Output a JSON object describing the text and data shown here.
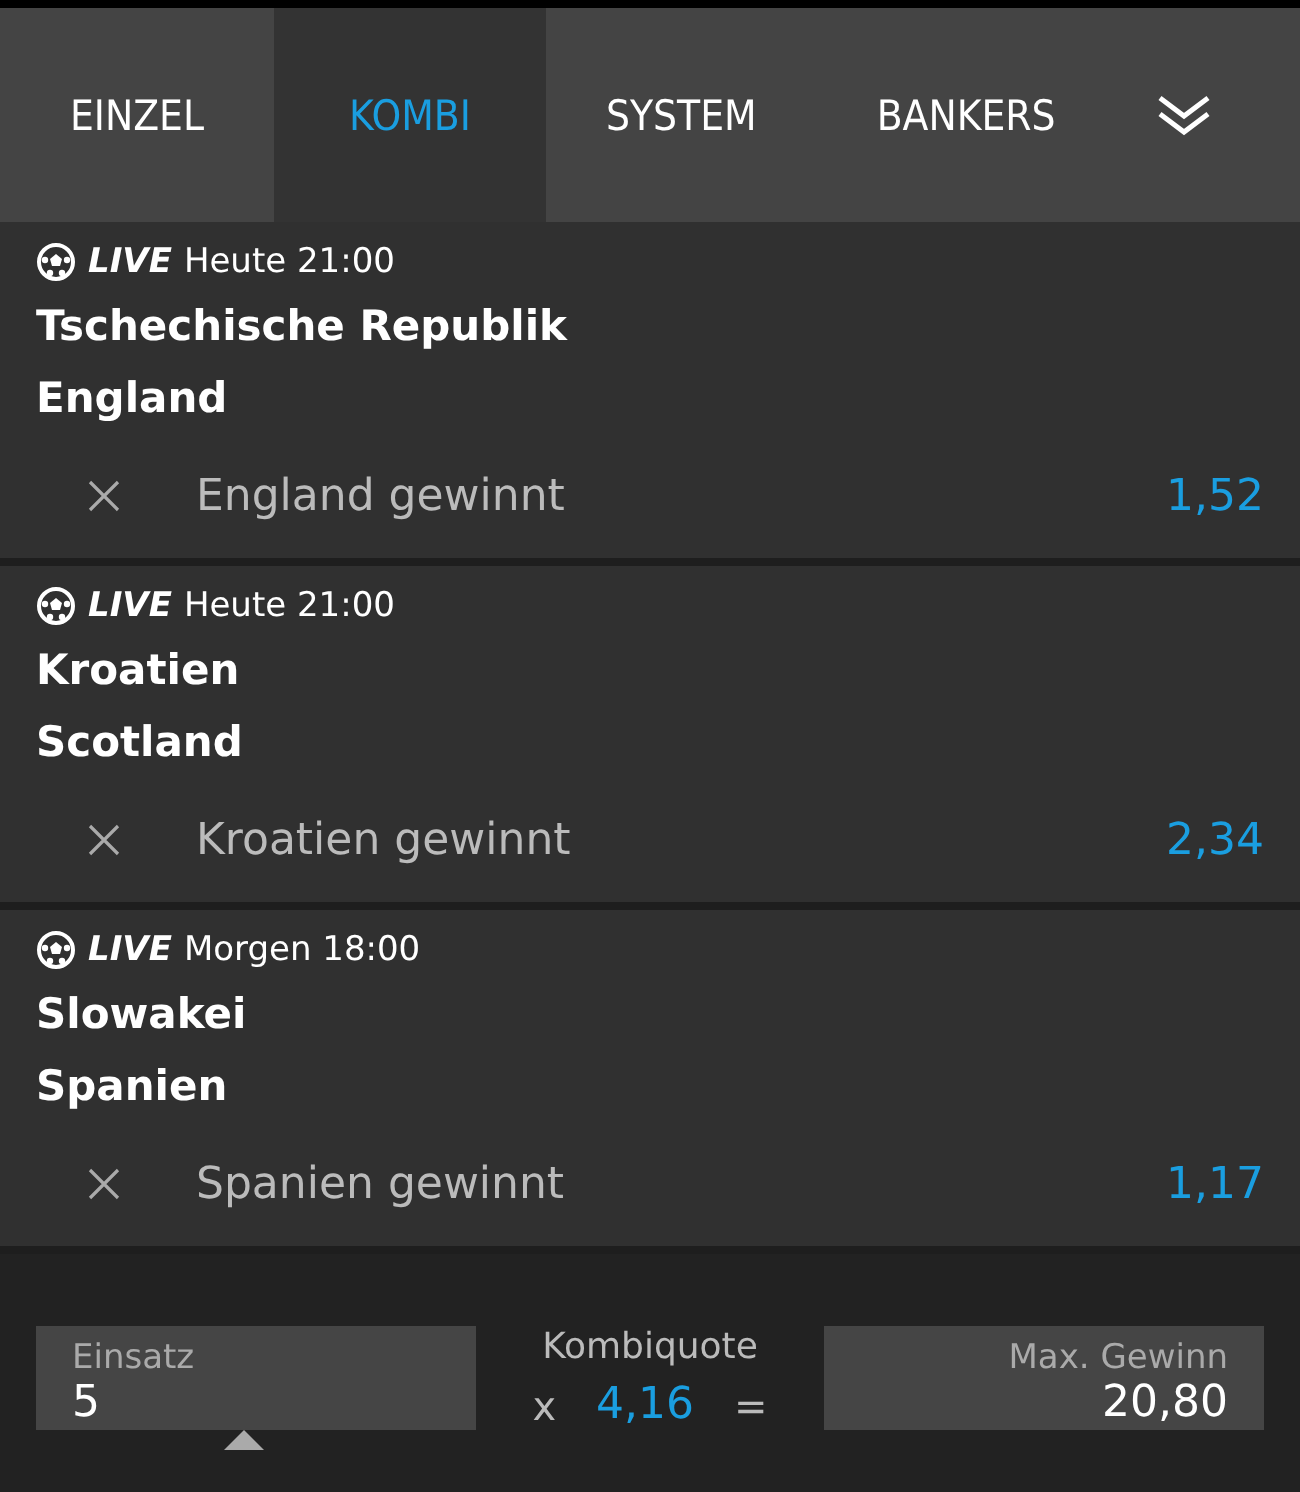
{
  "tabs": [
    {
      "label": "EINZEL",
      "selected": false
    },
    {
      "label": "KOMBI",
      "selected": true
    },
    {
      "label": "SYSTEM",
      "selected": false
    },
    {
      "label": "BANKERS",
      "selected": false
    }
  ],
  "bets": [
    {
      "live": "LIVE",
      "time": "Heute 21:00",
      "home": "Tschechische Republik",
      "away": "England",
      "selection": "England gewinnt",
      "odds": "1,52"
    },
    {
      "live": "LIVE",
      "time": "Heute 21:00",
      "home": "Kroatien",
      "away": "Scotland",
      "selection": "Kroatien gewinnt",
      "odds": "2,34"
    },
    {
      "live": "LIVE",
      "time": "Morgen 18:00",
      "home": "Slowakei",
      "away": "Spanien",
      "selection": "Spanien gewinnt",
      "odds": "1,17"
    }
  ],
  "summary": {
    "stake_label": "Einsatz",
    "stake": "5",
    "odds_label": "Kombiquote",
    "times": "x",
    "total_odds": "4,16",
    "equals": "=",
    "win_label": "Max. Gewinn",
    "win": "20,80"
  }
}
